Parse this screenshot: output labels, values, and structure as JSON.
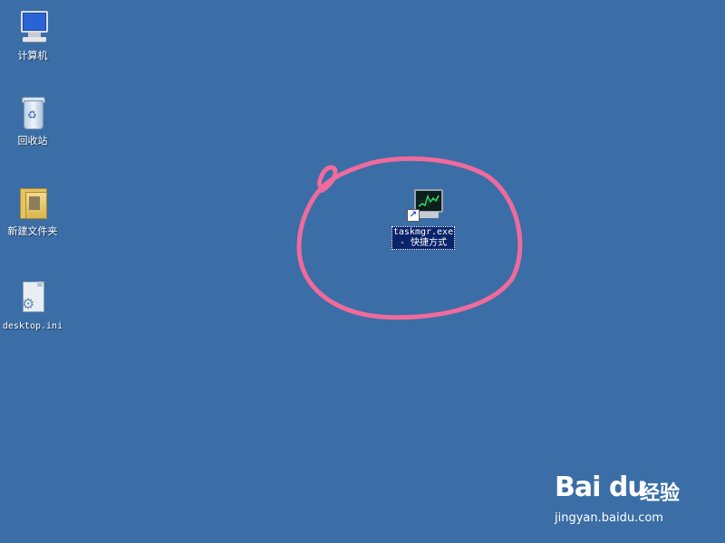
{
  "desktop": {
    "background_color": "#3b6ea6",
    "icons": [
      {
        "label": "计算机",
        "icon": "computer-icon"
      },
      {
        "label": "回收站",
        "icon": "recycle-bin-icon"
      },
      {
        "label": "新建文件夹",
        "icon": "folder-icon"
      },
      {
        "label": "desktop.ini",
        "icon": "ini-file-icon"
      }
    ],
    "selected_shortcut": {
      "line1": "taskmgr.exe",
      "line2": "- 快捷方式",
      "icon": "task-manager-icon",
      "shortcut_badge": "shortcut-arrow-icon"
    }
  },
  "annotation": {
    "color": "#f06a9c"
  },
  "watermark": {
    "brand": "Bai du",
    "suffix": "经验",
    "url": "jingyan.baidu.com"
  }
}
